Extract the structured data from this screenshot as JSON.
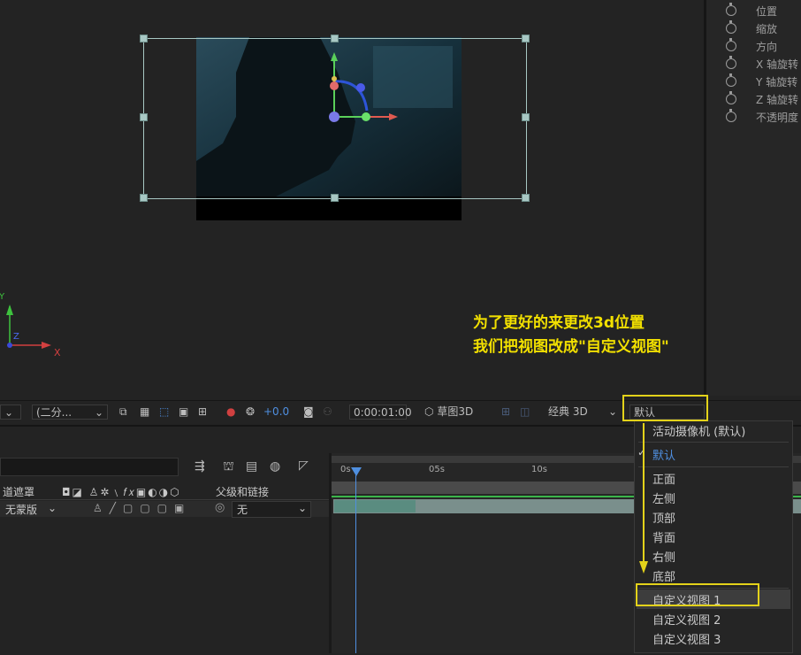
{
  "colors": {
    "accent_blue": "#4f8fe0",
    "highlight_yellow": "#f2e000"
  },
  "properties": [
    {
      "label": "位置"
    },
    {
      "label": "缩放"
    },
    {
      "label": "方向"
    },
    {
      "label": "X 轴旋转"
    },
    {
      "label": "Y 轴旋转"
    },
    {
      "label": "Z 轴旋转"
    },
    {
      "label": "不透明度"
    }
  ],
  "axes": {
    "x": "X",
    "y": "Y",
    "z": "Z"
  },
  "annotation": {
    "line1": "为了更好的来更改3d位置",
    "line2": "我们把视图改成\"自定义视图\""
  },
  "toolbar": {
    "resolution": "(二分...",
    "exposure": "+0.0",
    "timecode": "0:00:01:00",
    "draft3d": "草图3D",
    "renderer": "经典 3D",
    "view": "默认"
  },
  "timeline": {
    "columns": {
      "trkmat": "道遮罩",
      "parent": "父级和链接"
    },
    "row": {
      "trkmat_value": "无蒙版",
      "parent_value": "无"
    },
    "ruler": [
      "0s",
      "05s",
      "10s"
    ]
  },
  "view_menu": {
    "items": [
      {
        "label": "活动摄像机 (默认)",
        "checked": false
      },
      {
        "label": "默认",
        "checked": true
      },
      {
        "label": "正面",
        "checked": false
      },
      {
        "label": "左侧",
        "checked": false
      },
      {
        "label": "顶部",
        "checked": false
      },
      {
        "label": "背面",
        "checked": false
      },
      {
        "label": "右侧",
        "checked": false
      },
      {
        "label": "底部",
        "checked": false
      },
      {
        "label": "自定义视图 1",
        "checked": false
      },
      {
        "label": "自定义视图 2",
        "checked": false
      },
      {
        "label": "自定义视图 3",
        "checked": false
      }
    ]
  }
}
